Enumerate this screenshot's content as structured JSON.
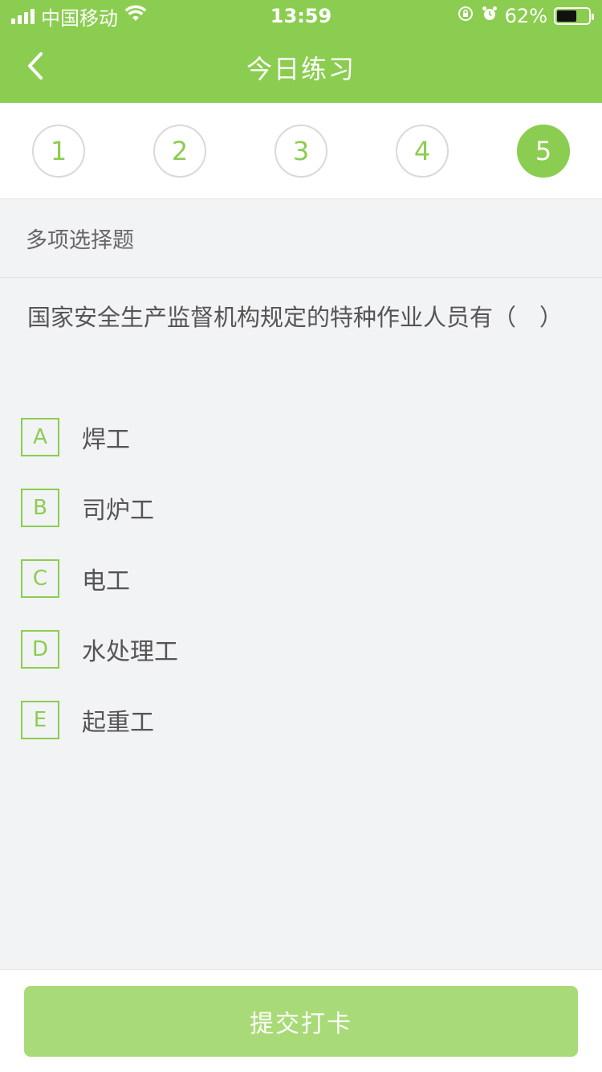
{
  "status_bar": {
    "carrier": "中国移动",
    "time": "13:59",
    "battery_percent": "62%",
    "battery_level": 0.62,
    "icons": [
      "signal-icon",
      "wifi-icon",
      "orientation-lock-icon",
      "alarm-icon",
      "battery-icon"
    ]
  },
  "header": {
    "title": "今日练习",
    "back_icon": "chevron-left-icon",
    "background": "#8bcd50"
  },
  "question_tabs": [
    {
      "label": "1",
      "active": false
    },
    {
      "label": "2",
      "active": false
    },
    {
      "label": "3",
      "active": false
    },
    {
      "label": "4",
      "active": false
    },
    {
      "label": "5",
      "active": true
    }
  ],
  "question": {
    "type": "多项选择题",
    "text": "国家安全生产监督机构规定的特种作业人员有（　）",
    "options": [
      {
        "key": "A",
        "text": "焊工"
      },
      {
        "key": "B",
        "text": "司炉工"
      },
      {
        "key": "C",
        "text": "电工"
      },
      {
        "key": "D",
        "text": "水处理工"
      },
      {
        "key": "E",
        "text": "起重工"
      }
    ]
  },
  "footer": {
    "submit_label": "提交打卡",
    "submit_color": "#a8db77"
  }
}
